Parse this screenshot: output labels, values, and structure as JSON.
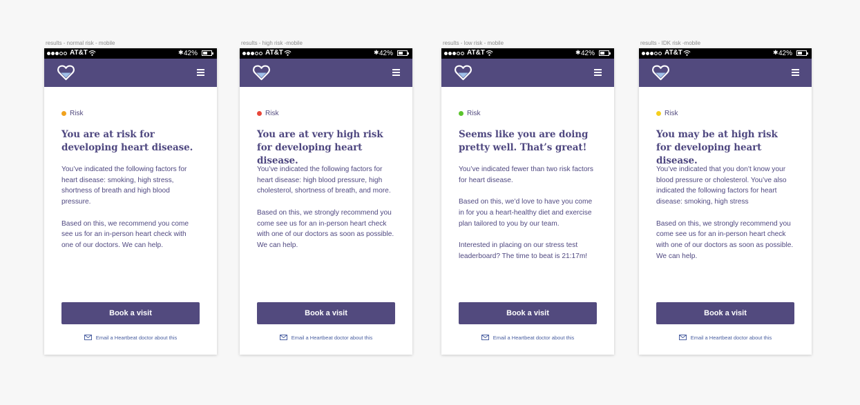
{
  "status_bar": {
    "carrier": "AT&T",
    "battery": "42%"
  },
  "common": {
    "risk_label": "Risk",
    "book_button_label": "Book a visit",
    "email_link_label": "Email a Heartbeat doctor about this"
  },
  "screens": [
    {
      "frame_label": "results - normal risk - mobile",
      "risk_color": "#f0a21e",
      "headline": "You are at risk for developing heart disease.",
      "paragraphs": [
        "You’ve indicated the following factors for heart disease: smoking, high stress, shortness of breath and high blood pressure.",
        "Based on this, we recommend you come see us for an in-person heart check with one of our doctors. We can help."
      ]
    },
    {
      "frame_label": "results - high risk -mobile",
      "risk_color": "#e8473a",
      "headline": "You are at very high risk for developing heart disease.",
      "paragraphs": [
        "You’ve indicated the following factors for heart disease: high blood pressure, high cholesterol, shortness of breath, and more.",
        "Based on this, we strongly recommend you come see us for an in-person heart check with one of our doctors as soon as possible. We can help."
      ]
    },
    {
      "frame_label": "results  - low risk - mobile",
      "risk_color": "#5bc42d",
      "headline": "Seems like you are doing pretty well. That’s great!",
      "paragraphs": [
        "You’ve indicated fewer than two risk factors for heart disease.",
        "Based on this, we’d love to have you come in for you a heart-healthy diet and exercise plan tailored to you by our team.",
        "Interested in placing on our stress test leaderboard? The time to beat is 21:17m!"
      ]
    },
    {
      "frame_label": "results - IDK risk -mobile",
      "risk_color": "#f5cf1e",
      "headline": "You may be at high risk for developing heart disease.",
      "paragraphs": [
        "You’ve indicated that you don’t know your blood pressure or cholesterol. You’ve also indicated the following factors for heart disease: smoking, high stress",
        "Based on this, we strongly recommend you come see us for an in-person heart check with one of our doctors as soon as possible. We can help."
      ]
    }
  ]
}
